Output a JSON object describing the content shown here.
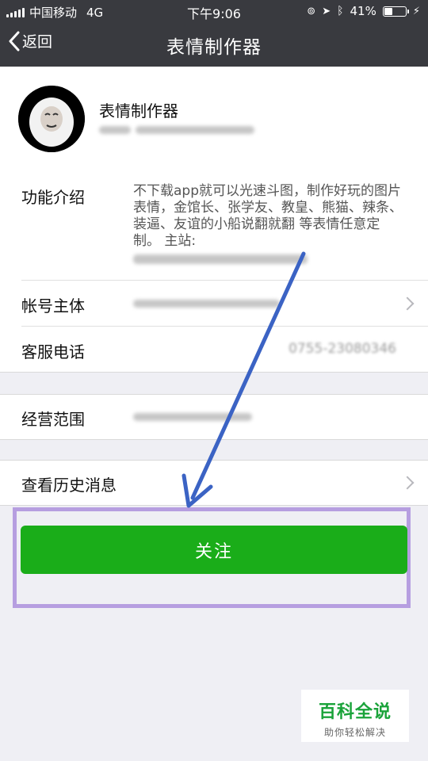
{
  "status_bar": {
    "carrier": "中国移动",
    "network": "4G",
    "time": "下午9:06",
    "battery": "41%",
    "battery_level": 0.41
  },
  "nav": {
    "back_label": "返回",
    "title": "表情制作器"
  },
  "profile": {
    "name": "表情制作器"
  },
  "info": {
    "intro_label": "功能介绍",
    "intro_text": "不下载app就可以光速斗图，制作好玩的图片表情，金馆长、张学友、教皇、熊猫、辣条、装逼、友谊的小船说翻就翻 等表情任意定制。 主站:",
    "account_label": "帐号主体",
    "phone_label": "客服电话",
    "phone_value": "0755-23080346"
  },
  "scope": {
    "label": "经营范围"
  },
  "history": {
    "label": "查看历史消息"
  },
  "follow_button": {
    "label": "关注"
  },
  "watermark": {
    "title": "百科全说",
    "subtitle": "助你轻松解决"
  },
  "colors": {
    "navbar": "#393a3f",
    "follow_green": "#1aad19",
    "highlight_purple": "#b69ee0",
    "arrow_blue": "#3b63c4"
  }
}
